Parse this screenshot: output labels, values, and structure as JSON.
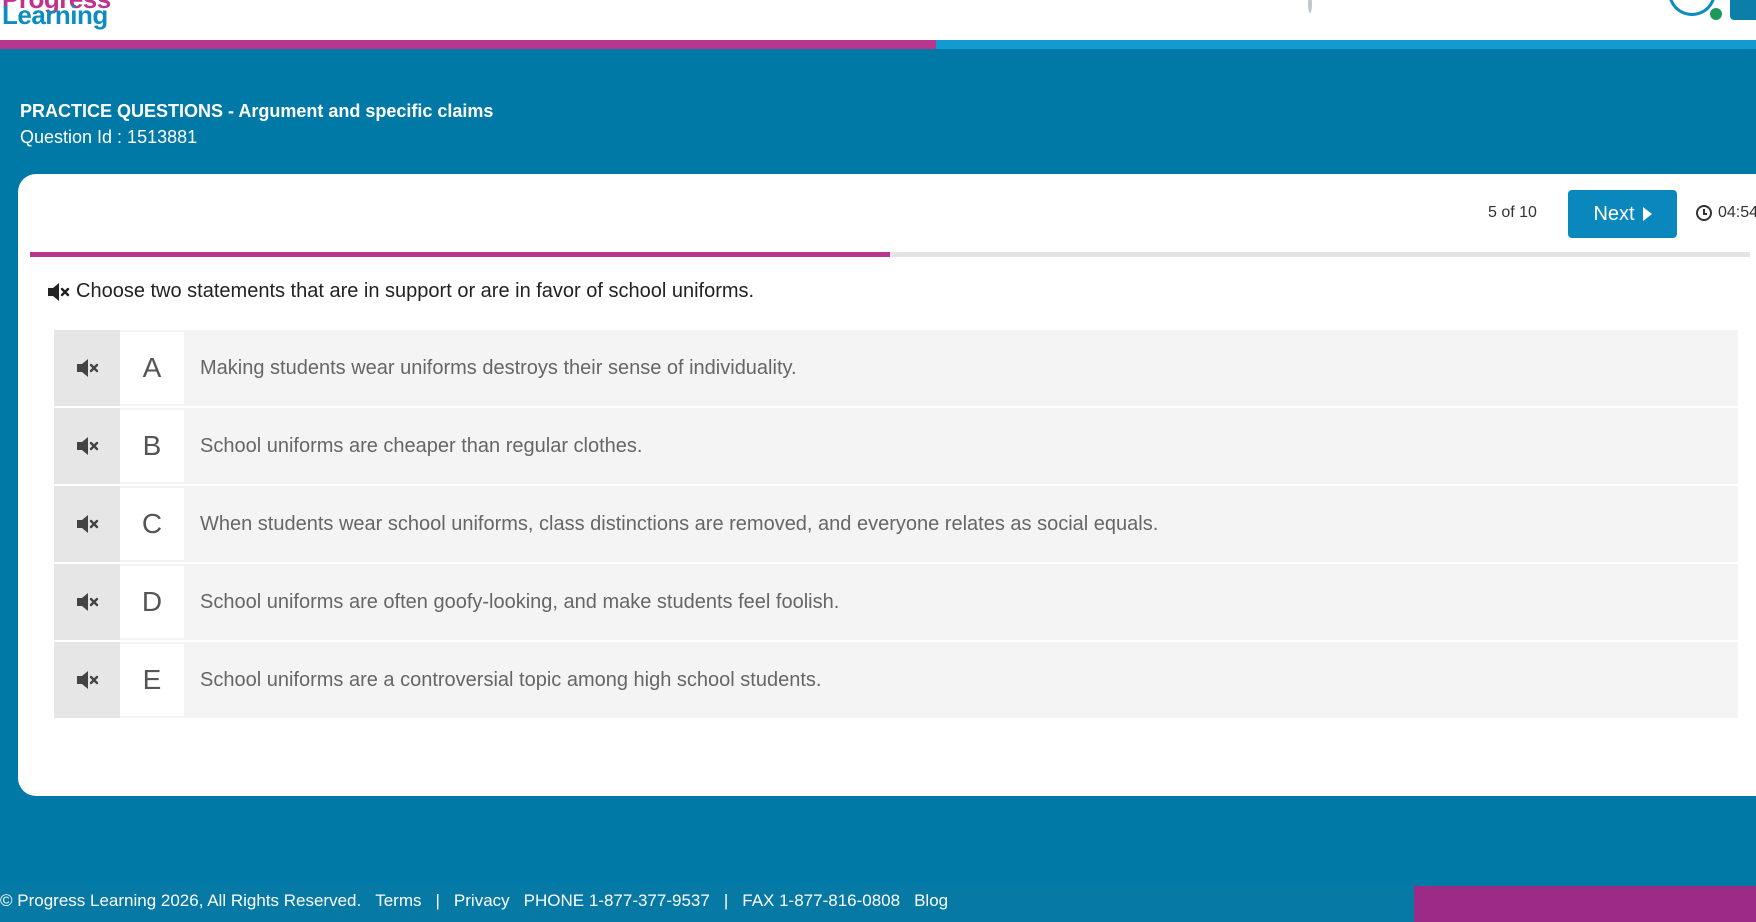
{
  "brand": {
    "logo_top": "Progress",
    "logo_bottom": "Learning"
  },
  "header": {
    "title": "PRACTICE QUESTIONS - Argument and specific claims",
    "question_id": "Question Id : 1513881"
  },
  "quiz": {
    "count": "5 of 10",
    "next_label": "Next",
    "timer": "04:54",
    "progress_fraction": 0.5,
    "prompt": "Choose two statements that are in support or are in favor of school uniforms.",
    "options": [
      {
        "letter": "A",
        "text": "Making students wear uniforms destroys their sense of individuality."
      },
      {
        "letter": "B",
        "text": "School uniforms are cheaper than regular clothes."
      },
      {
        "letter": "C",
        "text": "When students wear school uniforms, class distinctions are removed, and everyone relates as social equals."
      },
      {
        "letter": "D",
        "text": "School uniforms are often goofy-looking, and make students feel foolish."
      },
      {
        "letter": "E",
        "text": "School uniforms are a controversial topic among high school students."
      }
    ]
  },
  "footer": {
    "copyright": "© Progress Learning 2026, All Rights Reserved.",
    "terms": "Terms",
    "privacy": "Privacy",
    "phone": "PHONE 1-877-377-9537",
    "fax": "FAX 1-877-816-0808",
    "blog": "Blog",
    "separator": "|"
  },
  "colors": {
    "page_bg": "#0079a7",
    "magenta": "#b7378f",
    "accent_blue": "#0a87bd",
    "option_bg": "#f4f4f4"
  },
  "icons": {
    "audio_muted": "speaker-muted-icon",
    "clock": "clock-icon",
    "next_arrow": "caret-right-icon"
  }
}
